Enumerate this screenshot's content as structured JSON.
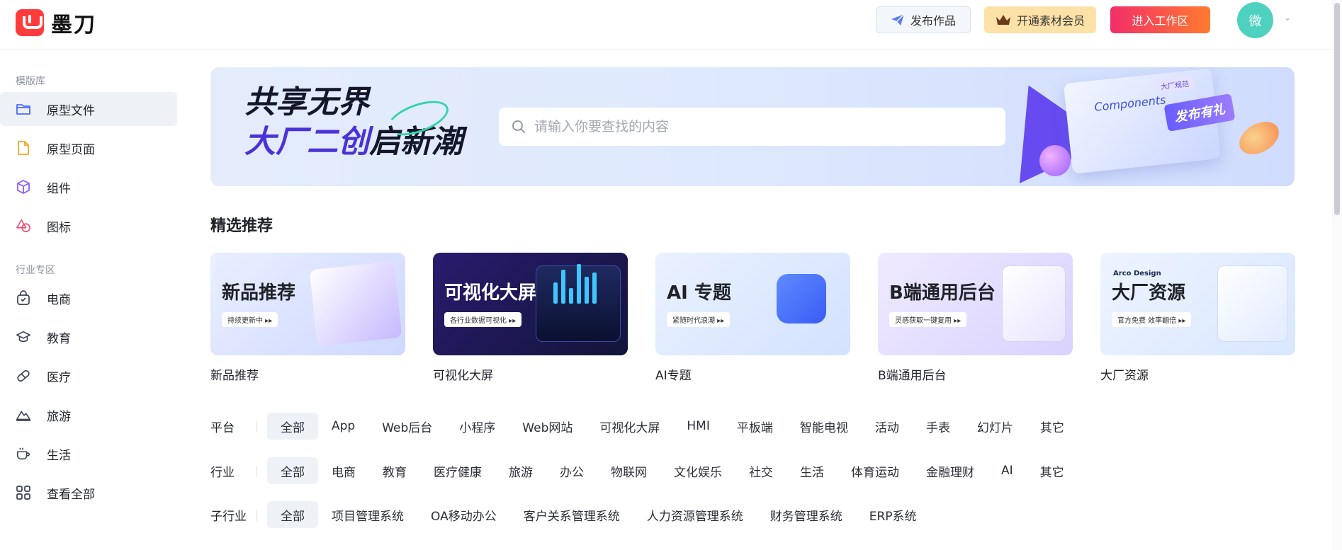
{
  "header": {
    "logo_text": "墨刀",
    "publish_label": "发布作品",
    "vip_label": "开通素材会员",
    "workspace_label": "进入工作区",
    "avatar_text": "微"
  },
  "sidebar": {
    "section1_title": "模版库",
    "section1_items": [
      {
        "label": "原型文件",
        "icon": "folder-icon"
      },
      {
        "label": "原型页面",
        "icon": "file-icon"
      },
      {
        "label": "组件",
        "icon": "cube-icon"
      },
      {
        "label": "图标",
        "icon": "shapes-icon"
      }
    ],
    "section2_title": "行业专区",
    "section2_items": [
      {
        "label": "电商",
        "icon": "bag-icon"
      },
      {
        "label": "教育",
        "icon": "graduation-icon"
      },
      {
        "label": "医疗",
        "icon": "pill-icon"
      },
      {
        "label": "旅游",
        "icon": "mountain-icon"
      },
      {
        "label": "生活",
        "icon": "coffee-icon"
      },
      {
        "label": "查看全部",
        "icon": "grid-icon"
      }
    ]
  },
  "banner": {
    "slogan_line1": "共享无界",
    "slogan_line2a": "大厂二创",
    "slogan_line2b": "启新潮",
    "search_placeholder": "请输入你要查找的内容",
    "card_text": "Components",
    "card_tag": "大厂规范",
    "gift_text": "发布有礼"
  },
  "featured": {
    "title": "精选推荐",
    "cards": [
      {
        "title": "新品推荐",
        "pill": "持续更新中 ▸▸",
        "label": "新品推荐"
      },
      {
        "title": "可视化大屏",
        "pill": "各行业数据可视化 ▸▸",
        "label": "可视化大屏"
      },
      {
        "title": "AI 专题",
        "pill": "紧随时代浪潮 ▸▸",
        "label": "AI专题"
      },
      {
        "title": "B端通用后台",
        "pill": "灵感获取一键复用 ▸▸",
        "label": "B端通用后台"
      },
      {
        "title": "大厂资源",
        "pill": "官方免费 效率翻倍 ▸▸",
        "brand": "Arco Design",
        "label": "大厂资源"
      }
    ]
  },
  "filters": {
    "platform": {
      "label": "平台",
      "options": [
        "全部",
        "App",
        "Web后台",
        "小程序",
        "Web网站",
        "可视化大屏",
        "HMI",
        "平板端",
        "智能电视",
        "活动",
        "手表",
        "幻灯片",
        "其它"
      ]
    },
    "industry": {
      "label": "行业",
      "options": [
        "全部",
        "电商",
        "教育",
        "医疗健康",
        "旅游",
        "办公",
        "物联网",
        "文化娱乐",
        "社交",
        "生活",
        "体育运动",
        "金融理财",
        "AI",
        "其它"
      ]
    },
    "sub_industry": {
      "label": "子行业",
      "options": [
        "全部",
        "项目管理系统",
        "OA移动办公",
        "客户关系管理系统",
        "人力资源管理系统",
        "财务管理系统",
        "ERP系统"
      ]
    }
  },
  "colors": {
    "brand_red": "#ff3b3b",
    "cta_gradient_start": "#f22e68",
    "cta_gradient_end": "#ff7b2f",
    "avatar": "#4fd1c0"
  }
}
